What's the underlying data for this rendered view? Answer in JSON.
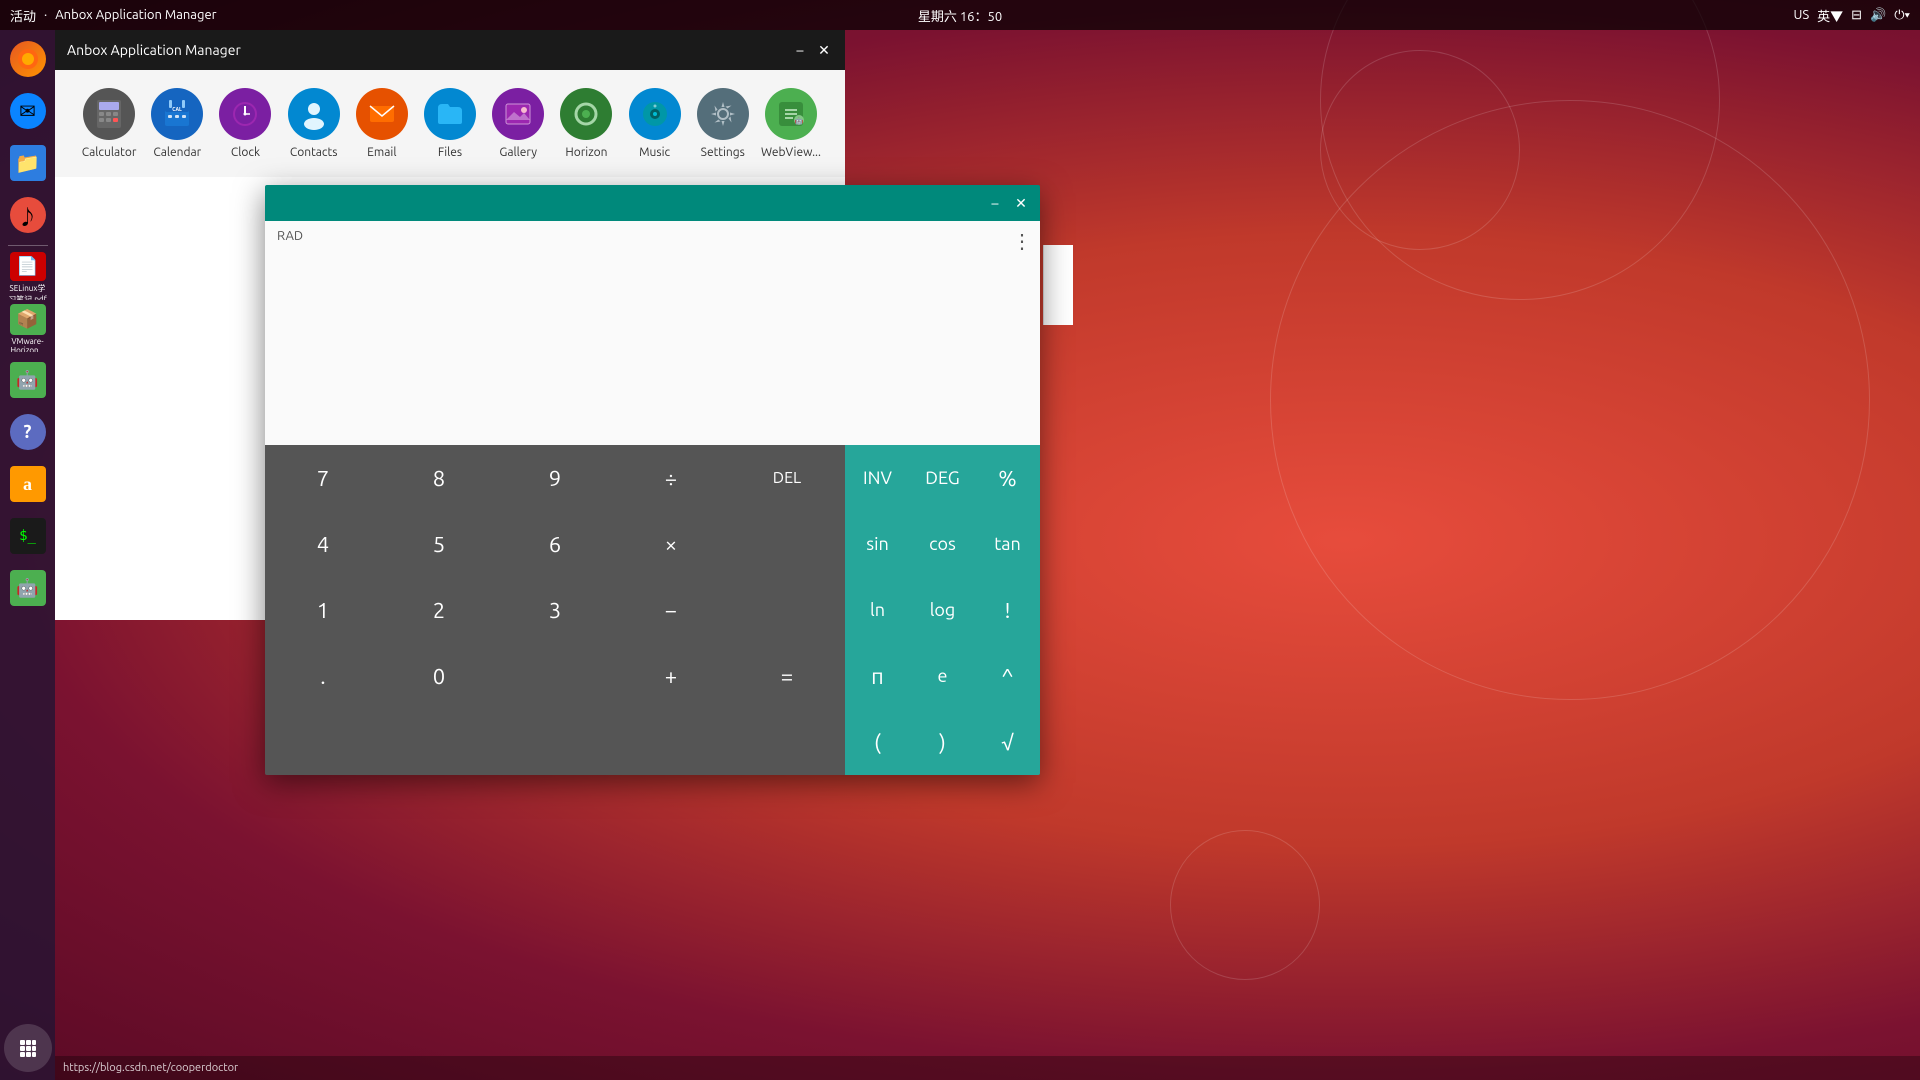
{
  "topbar": {
    "activity_label": "活动",
    "app_name": "Anbox Application Manager",
    "datetime": "星期六 16：50",
    "lang": "英▼",
    "region": "US"
  },
  "dock": {
    "icons": [
      {
        "name": "firefox",
        "label": "",
        "bg": "#e55722",
        "symbol": "🦊"
      },
      {
        "name": "thunderbird",
        "label": "",
        "bg": "#0a84ff",
        "symbol": "✉"
      },
      {
        "name": "files",
        "label": "",
        "bg": "#2d7de0",
        "symbol": "📁"
      },
      {
        "name": "rhythmbox",
        "label": "",
        "bg": "#e74c3c",
        "symbol": "♪"
      },
      {
        "name": "sebooks",
        "label": "SELinux学\n习笔记.pdf",
        "bg": "#cc0000",
        "symbol": "📄"
      },
      {
        "name": "vmware",
        "label": "VMware-\nHorizon-\nClient-An...",
        "bg": "#4caf50",
        "symbol": "📦"
      },
      {
        "name": "anbox",
        "label": "",
        "bg": "#4caf50",
        "symbol": "🤖"
      },
      {
        "name": "help",
        "label": "",
        "bg": "#5c6bc0",
        "symbol": "?"
      },
      {
        "name": "amazon",
        "label": "",
        "bg": "#ff9900",
        "symbol": "a"
      },
      {
        "name": "terminal",
        "label": "",
        "bg": "#1a1a1a",
        "symbol": "⬛"
      },
      {
        "name": "anbox2",
        "label": "",
        "bg": "#4caf50",
        "symbol": "🤖"
      }
    ],
    "show_apps_label": "⋮⋮⋮"
  },
  "anbox_manager": {
    "title": "Anbox Application Manager",
    "apps": [
      {
        "name": "Calculator",
        "icon_char": "📱",
        "bg": "#555"
      },
      {
        "name": "Calendar",
        "icon_char": "📅",
        "bg": "#1565c0"
      },
      {
        "name": "Clock",
        "icon_char": "🕐",
        "bg": "#7b1fa2"
      },
      {
        "name": "Contacts",
        "icon_char": "👤",
        "bg": "#0288d1"
      },
      {
        "name": "Email",
        "icon_char": "✉",
        "bg": "#e65100"
      },
      {
        "name": "Files",
        "icon_char": "📁",
        "bg": "#0288d1"
      },
      {
        "name": "Gallery",
        "icon_char": "🖼",
        "bg": "#7b1fa2"
      },
      {
        "name": "Horizon",
        "icon_char": "◉",
        "bg": "#2e7d32"
      },
      {
        "name": "Music",
        "icon_char": "🎵",
        "bg": "#0288d1"
      },
      {
        "name": "Settings",
        "icon_char": "⚙",
        "bg": "#546e7a"
      },
      {
        "name": "WebView...",
        "icon_char": "🤖",
        "bg": "#4caf50"
      }
    ]
  },
  "calculator": {
    "title": "",
    "mode": "RAD",
    "numpad": {
      "rows": [
        [
          "7",
          "8",
          "9",
          "÷",
          "DEL"
        ],
        [
          "4",
          "5",
          "6",
          "×",
          ""
        ],
        [
          "1",
          "2",
          "3",
          "−",
          ""
        ],
        [
          ".",
          "0",
          "",
          "+",
          "="
        ]
      ]
    },
    "scipad": {
      "rows": [
        [
          "INV",
          "DEG",
          "%"
        ],
        [
          "sin",
          "cos",
          "tan"
        ],
        [
          "ln",
          "log",
          "!"
        ],
        [
          "π",
          "e",
          "^"
        ],
        [
          "(",
          ")",
          "√"
        ]
      ]
    }
  },
  "url_bar": {
    "url": "https://blog.csdn.net/cooperdoctor"
  }
}
